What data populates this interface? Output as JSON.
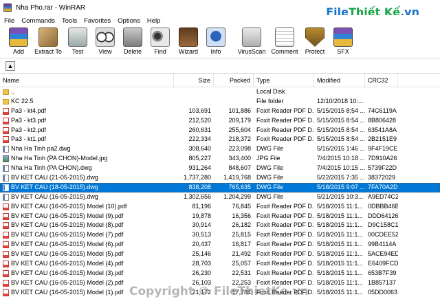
{
  "window": {
    "title": "Nha Pho.rar - WinRAR"
  },
  "brand": {
    "part1": "File",
    "part2": "Thiết Kế",
    "part3": ".vn"
  },
  "menu": [
    "File",
    "Commands",
    "Tools",
    "Favorites",
    "Options",
    "Help"
  ],
  "toolbar": [
    {
      "label": "Add",
      "icon": "add-icon"
    },
    {
      "label": "Extract To",
      "icon": "extract-icon"
    },
    {
      "label": "Test",
      "icon": "test-icon"
    },
    {
      "label": "View",
      "icon": "view-icon"
    },
    {
      "label": "Delete",
      "icon": "delete-icon"
    },
    {
      "label": "Find",
      "icon": "find-icon"
    },
    {
      "label": "Wizard",
      "icon": "wizard-icon"
    },
    {
      "label": "Info",
      "icon": "info-icon"
    },
    {
      "label": "VirusScan",
      "icon": "virusscan-icon"
    },
    {
      "label": "Comment",
      "icon": "comment-icon"
    },
    {
      "label": "Protect",
      "icon": "protect-icon"
    },
    {
      "label": "SFX",
      "icon": "sfx-icon"
    }
  ],
  "address": {
    "up_icon": "up-arrow-icon"
  },
  "columns": {
    "name": "Name",
    "size": "Size",
    "packed": "Packed",
    "type": "Type",
    "modified": "Modified",
    "crc": "CRC32"
  },
  "rows": [
    {
      "icon": "folder",
      "name": "..",
      "size": "",
      "packed": "",
      "type": "Local Disk",
      "modified": "",
      "crc": ""
    },
    {
      "icon": "folder",
      "name": "KC 22.5",
      "size": "",
      "packed": "",
      "type": "File folder",
      "modified": "12/10/2018 10:...",
      "crc": ""
    },
    {
      "icon": "pdf",
      "name": "Pa3 - kt4.pdf",
      "size": "103,691",
      "packed": "101,886",
      "type": "Foxit Reader PDF D...",
      "modified": "5/15/2015 8:54 ...",
      "crc": "74C6119A"
    },
    {
      "icon": "pdf",
      "name": "Pa3 - kt3.pdf",
      "size": "212,520",
      "packed": "209,179",
      "type": "Foxit Reader PDF D...",
      "modified": "5/15/2015 8:54 ...",
      "crc": "8B806428"
    },
    {
      "icon": "pdf",
      "name": "Pa3 - kt2.pdf",
      "size": "260,631",
      "packed": "255,604",
      "type": "Foxit Reader PDF D...",
      "modified": "5/15/2015 8:54 ...",
      "crc": "63541A8A"
    },
    {
      "icon": "pdf",
      "name": "Pa3 - kt1.pdf",
      "size": "222,334",
      "packed": "218,372",
      "type": "Foxit Reader PDF D...",
      "modified": "5/15/2015 8:54 ...",
      "crc": "2B2151E9"
    },
    {
      "icon": "dwg",
      "name": "Nha Ha Tinh pa2.dwg",
      "size": "308,640",
      "packed": "223,098",
      "type": "DWG File",
      "modified": "5/16/2015 1:46 ...",
      "crc": "9F4F19CE"
    },
    {
      "icon": "jpg",
      "name": "Nha Ha Tinh (PA CHON)-Model.jpg",
      "size": "805,227",
      "packed": "343,400",
      "type": "JPG File",
      "modified": "7/4/2015 10:18 ...",
      "crc": "7D910A26"
    },
    {
      "icon": "dwg",
      "name": "Nha Ha Tinh (PA CHON).dwg",
      "size": "931,264",
      "packed": "848,607",
      "type": "DWG File",
      "modified": "7/4/2015 10:15 ...",
      "crc": "5739F22D"
    },
    {
      "icon": "dwg",
      "name": "BV KET CAU (21-05-2015).dwg",
      "size": "1,737,280",
      "packed": "1,419,768",
      "type": "DWG File",
      "modified": "5/22/2015 7:35 ...",
      "crc": "38372029"
    },
    {
      "icon": "dwg",
      "name": "BV KET CAU (18-05-2015).dwg",
      "size": "838,208",
      "packed": "765,635",
      "type": "DWG File",
      "modified": "5/18/2015 9:07 ...",
      "crc": "7FA70A2D",
      "selected": true
    },
    {
      "icon": "dwg",
      "name": "BV KET CAU (16-05-2015).dwg",
      "size": "1,302,656",
      "packed": "1,204,299",
      "type": "DWG File",
      "modified": "5/21/2015 10:3...",
      "crc": "A9ED74C2"
    },
    {
      "icon": "pdf",
      "name": "BV KET CAU (16-05-2015) Model (10).pdf",
      "size": "81,196",
      "packed": "76,845",
      "type": "Foxit Reader PDF D...",
      "modified": "5/18/2015 11:1...",
      "crc": "0DBBB46B"
    },
    {
      "icon": "pdf",
      "name": "BV KET CAU (16-05-2015) Model (9).pdf",
      "size": "19,878",
      "packed": "16,356",
      "type": "Foxit Reader PDF D...",
      "modified": "5/18/2015 11:1...",
      "crc": "DDD64126"
    },
    {
      "icon": "pdf",
      "name": "BV KET CAU (16-05-2015) Model (8).pdf",
      "size": "30,914",
      "packed": "26,182",
      "type": "Foxit Reader PDF D...",
      "modified": "5/18/2015 11:1...",
      "crc": "D9C158C1"
    },
    {
      "icon": "pdf",
      "name": "BV KET CAU (16-05-2015) Model (7).pdf",
      "size": "30,513",
      "packed": "25,815",
      "type": "Foxit Reader PDF D...",
      "modified": "5/18/2015 11:1...",
      "crc": "00CDEE52"
    },
    {
      "icon": "pdf",
      "name": "BV KET CAU (16-05-2015) Model (6).pdf",
      "size": "20,437",
      "packed": "16,817",
      "type": "Foxit Reader PDF D...",
      "modified": "5/18/2015 11:1...",
      "crc": "99B4114A"
    },
    {
      "icon": "pdf",
      "name": "BV KET CAU (16-05-2015) Model (5).pdf",
      "size": "25,146",
      "packed": "21,492",
      "type": "Foxit Reader PDF D...",
      "modified": "5/18/2015 11:1...",
      "crc": "5ACE94ED"
    },
    {
      "icon": "pdf",
      "name": "BV KET CAU (16-05-2015) Model (4).pdf",
      "size": "28,703",
      "packed": "25,057",
      "type": "Foxit Reader PDF D...",
      "modified": "5/18/2015 11:1...",
      "crc": "E6409FCD"
    },
    {
      "icon": "pdf",
      "name": "BV KET CAU (16-05-2015) Model (3).pdf",
      "size": "26,230",
      "packed": "22,531",
      "type": "Foxit Reader PDF D...",
      "modified": "5/18/2015 11:1...",
      "crc": "653B7F39"
    },
    {
      "icon": "pdf",
      "name": "BV KET CAU (16-05-2015) Model (2).pdf",
      "size": "26,103",
      "packed": "22,253",
      "type": "Foxit Reader PDF D...",
      "modified": "5/18/2015 11:1...",
      "crc": "1B857137"
    },
    {
      "icon": "pdf",
      "name": "BV KET CAU (16-05-2015) Model (1).pdf",
      "size": "21,172",
      "packed": "17,784",
      "type": "Foxit Reader PDF D...",
      "modified": "5/18/2015 11:1...",
      "crc": "05DD0063"
    }
  ],
  "watermark": "Copyright © FileThietKe.vn",
  "colors": {
    "selection": "#0078d7",
    "brand_blue": "#1a73c9",
    "brand_green": "#17a44a"
  }
}
